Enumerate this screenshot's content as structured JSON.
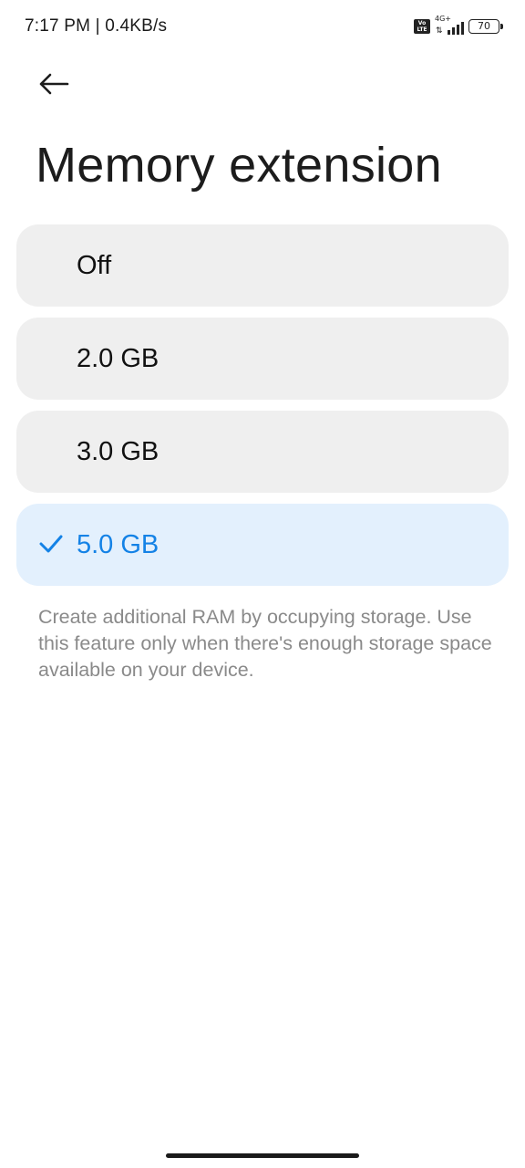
{
  "status_bar": {
    "time_speed": "7:17 PM | 0.4KB/s",
    "volte_label": "Vo LTE",
    "network_type": "4G+",
    "battery_level": "70"
  },
  "header": {
    "back_icon": "arrow-left-icon",
    "title": "Memory extension"
  },
  "options": [
    {
      "label": "Off",
      "selected": false
    },
    {
      "label": "2.0 GB",
      "selected": false
    },
    {
      "label": "3.0 GB",
      "selected": false
    },
    {
      "label": "5.0 GB",
      "selected": true
    }
  ],
  "selected_icon": "checkmark-icon",
  "description": "Create additional RAM by occupying storage. Use this feature only when there's enough storage space available on your device.",
  "colors": {
    "accent": "#1482e6",
    "selected_background": "#e3f0fd",
    "option_background": "#efefef",
    "description_text": "#8a8a8a"
  }
}
